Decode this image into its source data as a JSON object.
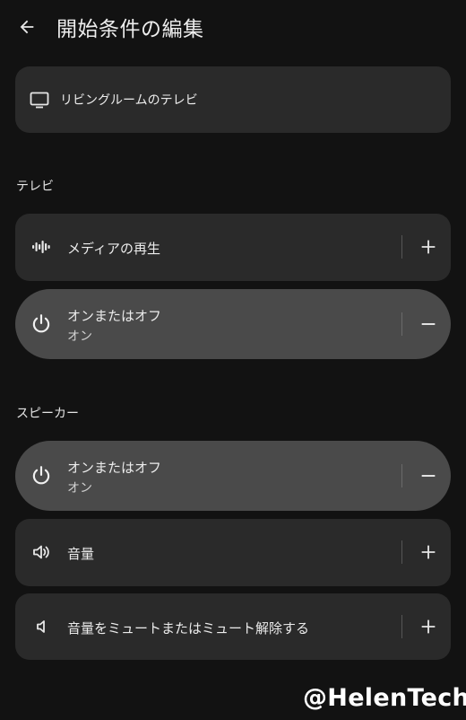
{
  "header": {
    "title": "開始条件の編集",
    "back_icon": "arrow-left-icon"
  },
  "device": {
    "label": "リビングルームのテレビ",
    "icon": "tv-icon"
  },
  "sections": [
    {
      "title": "テレビ",
      "items": [
        {
          "label": "メディアの再生",
          "icon": "waveform-icon",
          "action": "+",
          "selected": false
        },
        {
          "label": "オンまたはオフ",
          "sublabel": "オン",
          "icon": "power-icon",
          "action": "−",
          "selected": true
        }
      ]
    },
    {
      "title": "スピーカー",
      "items": [
        {
          "label": "オンまたはオフ",
          "sublabel": "オン",
          "icon": "power-icon",
          "action": "−",
          "selected": true
        },
        {
          "label": "音量",
          "icon": "volume-icon",
          "action": "+",
          "selected": false
        },
        {
          "label": "音量をミュートまたはミュート解除する",
          "icon": "speaker-mute-icon",
          "action": "+",
          "selected": false
        }
      ]
    }
  ],
  "watermark": "@HelenTech",
  "colors": {
    "background": "#121212",
    "card": "#2a2a2a",
    "selected_card": "#4a4a4a"
  }
}
